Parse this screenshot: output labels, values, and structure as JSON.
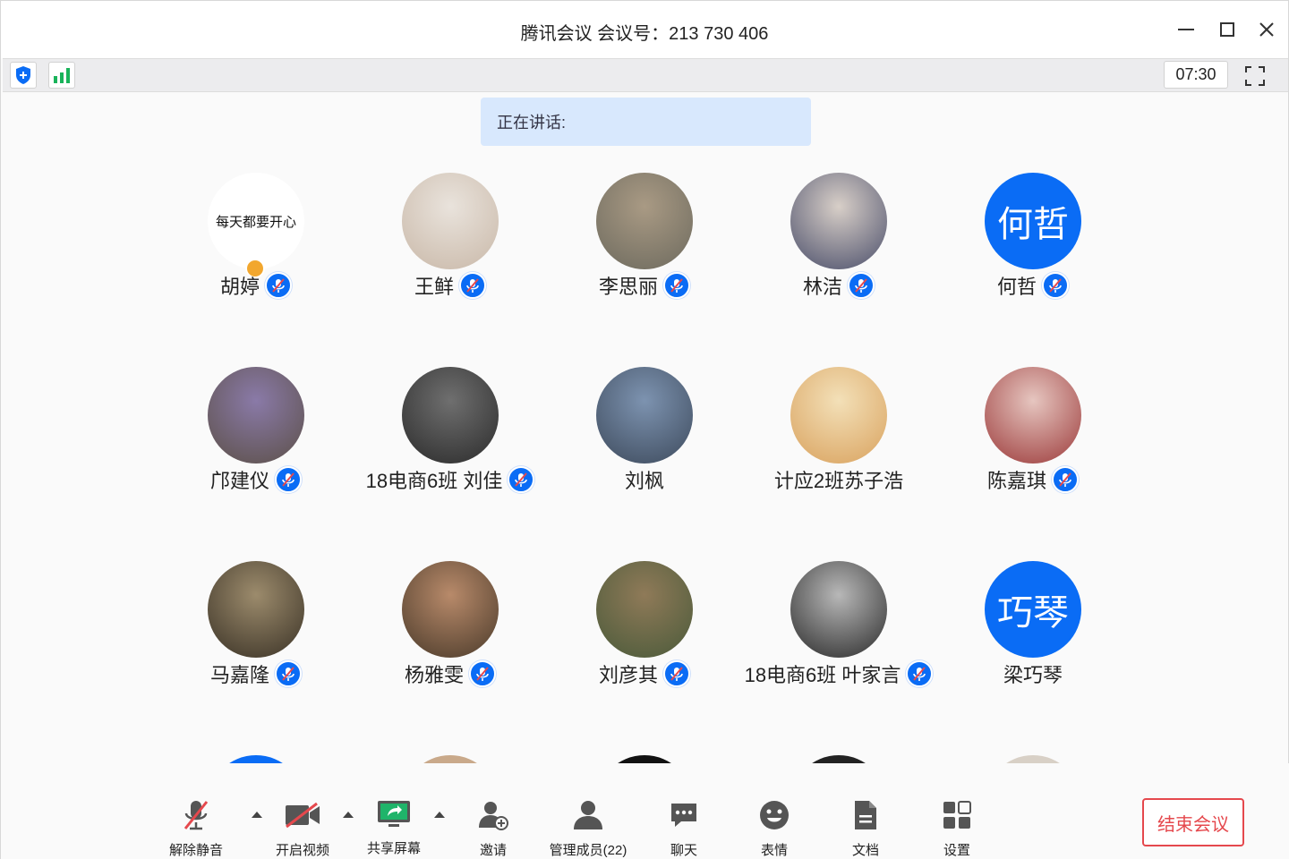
{
  "window": {
    "title": "腾讯会议 会议号：213 730 406"
  },
  "infobar": {
    "timer": "07:30"
  },
  "speaking": {
    "label": "正在讲话:"
  },
  "participants": [
    {
      "name": "胡婷",
      "avatar_text": "每天都要开心",
      "mic": true,
      "host": true
    },
    {
      "name": "王鲜",
      "avatar_text": "",
      "mic": true
    },
    {
      "name": "李思丽",
      "avatar_text": "",
      "mic": true
    },
    {
      "name": "林洁",
      "avatar_text": "",
      "mic": true
    },
    {
      "name": "何哲",
      "avatar_text": "何哲",
      "mic": true
    },
    {
      "name": "邝建仪",
      "avatar_text": "",
      "mic": true
    },
    {
      "name": "18电商6班 刘佳",
      "avatar_text": "",
      "mic": true
    },
    {
      "name": "刘枫",
      "avatar_text": "",
      "mic": false
    },
    {
      "name": "计应2班苏子浩",
      "avatar_text": "",
      "mic": false
    },
    {
      "name": "陈嘉琪",
      "avatar_text": "",
      "mic": true
    },
    {
      "name": "马嘉隆",
      "avatar_text": "",
      "mic": true
    },
    {
      "name": "杨雅雯",
      "avatar_text": "",
      "mic": true
    },
    {
      "name": "刘彦其",
      "avatar_text": "",
      "mic": true
    },
    {
      "name": "18电商6班 叶家言",
      "avatar_text": "",
      "mic": true
    },
    {
      "name": "梁巧琴",
      "avatar_text": "巧琴",
      "mic": false
    }
  ],
  "toolbar": {
    "unmute": "解除静音",
    "video": "开启视频",
    "share": "共享屏幕",
    "invite": "邀请",
    "members": "管理成员(22)",
    "chat": "聊天",
    "emoji": "表情",
    "docs": "文档",
    "settings": "设置",
    "end": "结束会议"
  },
  "colors": {
    "accent": "#0a6cf5",
    "danger": "#e5484d",
    "speaking_bg": "#d8e8fd"
  }
}
